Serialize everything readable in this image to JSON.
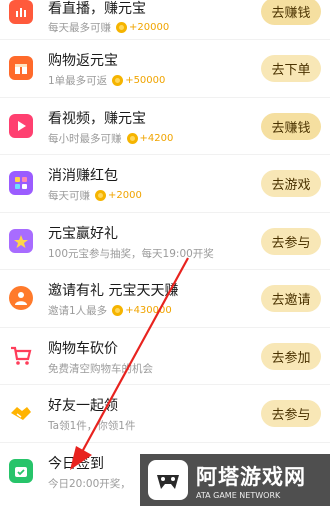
{
  "rows": [
    {
      "title": "看直播，赚元宝",
      "sub": "每天最多可赚",
      "reward": "+20000",
      "button": "去赚钱",
      "icon": "live-icon",
      "color": "#ff5a3c"
    },
    {
      "title": "购物返元宝",
      "sub": "1单最多可返",
      "reward": "+50000",
      "button": "去下单",
      "icon": "gift-icon",
      "color": "#ff6a2b"
    },
    {
      "title": "看视频，赚元宝",
      "sub": "每小时最多可赚",
      "reward": "+4200",
      "button": "去赚钱",
      "icon": "video-icon",
      "color": "#ff4070"
    },
    {
      "title": "消消赚红包",
      "sub": "每天可赚",
      "reward": "+2000",
      "button": "去游戏",
      "icon": "puzzle-icon",
      "color": "#9b5cff"
    },
    {
      "title": "元宝赢好礼",
      "sub": "100元宝参与抽奖，每天19:00开奖",
      "reward": "",
      "button": "去参与",
      "icon": "prize-icon",
      "color": "#a86cff"
    },
    {
      "title": "邀请有礼 元宝天天赚",
      "sub": "邀请1人最多",
      "reward": "+430000",
      "button": "去邀请",
      "icon": "invite-icon",
      "color": "#ff7a2b"
    },
    {
      "title": "购物车砍价",
      "sub": "免费清空购物车的机会",
      "reward": "",
      "button": "去参加",
      "icon": "cart-icon",
      "color": "#ff3d5a"
    },
    {
      "title": "好友一起领",
      "sub": "Ta领1件，你领1件",
      "reward": "",
      "button": "去参与",
      "icon": "handshake-icon",
      "color": "#ffb300"
    },
    {
      "title": "今日签到",
      "sub": "今日20:00开奖，",
      "reward": "",
      "button": "",
      "icon": "calendar-icon",
      "color": "#27c46a"
    }
  ],
  "watermark": {
    "main": "阿塔游戏网",
    "sub": "ATA GAME NETWORK"
  }
}
